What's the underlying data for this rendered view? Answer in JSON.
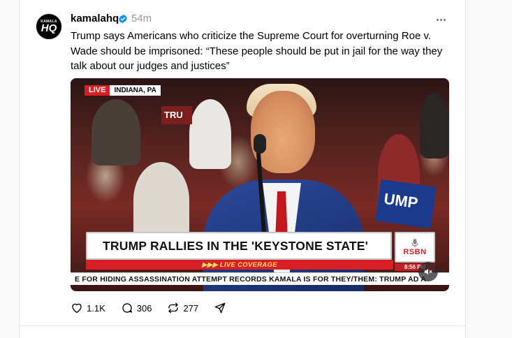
{
  "post": {
    "avatar_top": "KAMALA",
    "avatar_bottom": "HQ",
    "username": "kamalahq",
    "time": "54m",
    "text": "Trump says Americans who criticize the Supreme Court for overturning Roe v. Wade should be imprisoned: “These people should be put in jail for the way they talk about our judges and justices”"
  },
  "video": {
    "live_label": "LIVE",
    "location": "INDIANA, PA",
    "headline": "TRUMP RALLIES IN THE 'KEYSTONE STATE'",
    "live_coverage": "▶▶▶ LIVE COVERAGE",
    "network": "RSBN",
    "clock": "8:56 PM",
    "ticker": "E FOR HIDING ASSASSINATION ATTEMPT RECORDS    KAMALA IS FOR THEY/THEM: TRUMP AD A",
    "sign_left": "TRU",
    "sign_right": "UMP"
  },
  "actions": {
    "likes": "1.1K",
    "replies": "306",
    "reposts": "277"
  },
  "colors": {
    "verified_blue": "#0095f6",
    "live_red": "#d91f26",
    "suit_blue": "#1d3577"
  }
}
